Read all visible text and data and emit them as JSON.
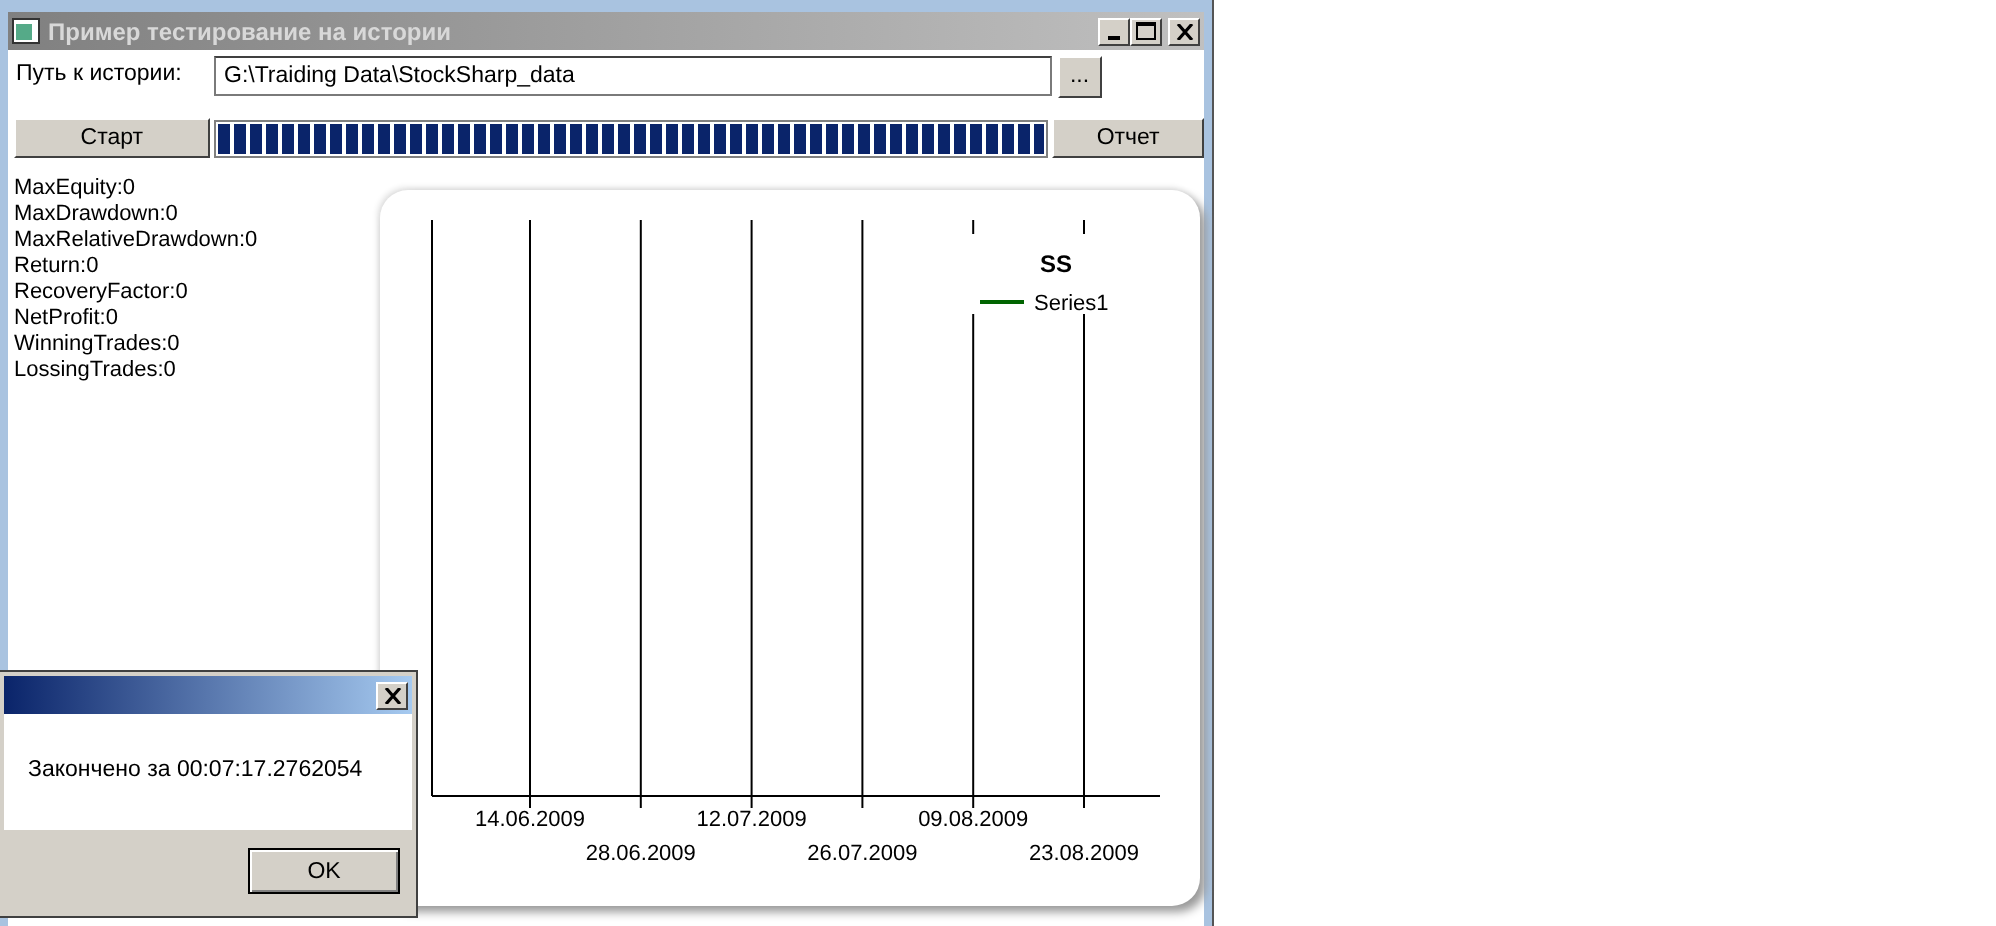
{
  "window": {
    "title": "Пример тестирование на истории"
  },
  "history_path": {
    "label": "Путь к истории:",
    "value": "G:\\Traiding Data\\StockSharp_data",
    "browse_button": "..."
  },
  "start_button": "Старт",
  "progress": {
    "level": 1
  },
  "report_button": "Отчет",
  "stats": [
    "MaxEquity:0",
    "MaxDrawdown:0",
    "MaxRelativeDrawdown:0",
    "Return:0",
    "RecoveryFactor:0",
    "NetProfit:0",
    "WinningTrades:0",
    "LossingTrades:0"
  ],
  "chart_data": {
    "type": "other",
    "title": "SS",
    "categories": [
      "14.06.2009",
      "28.06.2009",
      "12.07.2009",
      "26.07.2009",
      "09.08.2009",
      "23.08.2009"
    ],
    "series": [
      {
        "name": "Series1",
        "color": "#006400",
        "values": [
          null,
          null,
          null,
          null,
          null,
          null
        ]
      }
    ]
  },
  "dialog": {
    "message": "Закончено за 00:07:17.2762054",
    "button": "OK"
  }
}
